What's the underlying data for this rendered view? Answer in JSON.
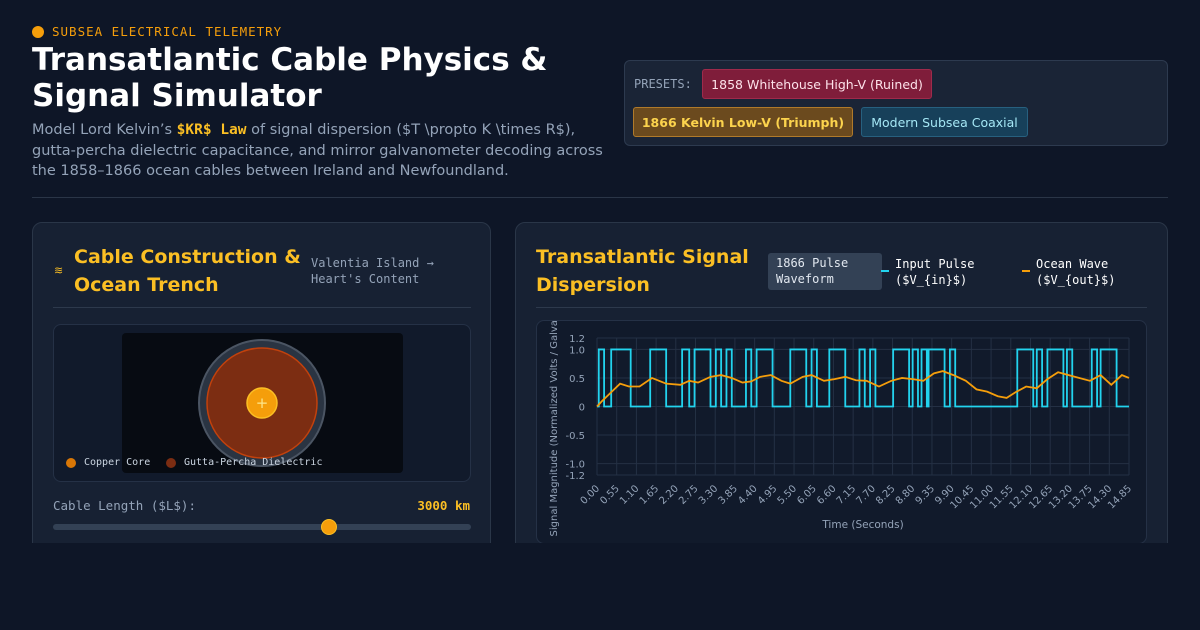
{
  "header": {
    "eyebrow": "SUBSEA ELECTRICAL TELEMETRY",
    "title": "Transatlantic Cable Physics & Signal Simulator",
    "desc_prefix": "Model Lord Kelvin’s ",
    "desc_code": "$KR$ Law",
    "desc_suffix": " of signal dispersion ($T \\propto K \\times R$), gutta-percha dielectric capacitance, and mirror galvanometer decoding across the 1858–1866 ocean cables between Ireland and Newfoundland."
  },
  "presets": {
    "label": "PRESETS:",
    "items": [
      {
        "label": "1858 Whitehouse High-V (Ruined)"
      },
      {
        "label": "1866 Kelvin Low-V (Triumph)"
      },
      {
        "label": "Modern Subsea Coaxial"
      }
    ]
  },
  "cable_panel": {
    "icon": "wave-icon",
    "title": "Cable Construction & Ocean Trench",
    "route": "Valentia Island → Heart's Content",
    "legend": [
      {
        "label": "Copper Core",
        "color": "#d97706"
      },
      {
        "label": "Gutta-Percha Dielectric",
        "color": "#7c2d12"
      }
    ],
    "length_label": "Cable Length ($L$):",
    "length_value": "3000 km",
    "length_fraction": 0.66
  },
  "signal_panel": {
    "title": "Transatlantic Signal Dispersion",
    "badge": "1866 Pulse Waveform",
    "legend": [
      {
        "label": "Input Pulse ($V_{in}$)",
        "color": "#22d3ee"
      },
      {
        "label": "Ocean Wave ($V_{out}$)",
        "color": "#f59e0b"
      }
    ]
  },
  "chart_data": {
    "type": "line",
    "xlabel": "Time (Seconds)",
    "ylabel": "Signal Magnitude (Normalized Volts / Galvanometer",
    "x_ticks": [
      "0.00",
      "0.55",
      "1.10",
      "1.65",
      "2.20",
      "2.75",
      "3.30",
      "3.85",
      "4.40",
      "4.95",
      "5.50",
      "6.05",
      "6.60",
      "7.15",
      "7.70",
      "8.25",
      "8.80",
      "9.35",
      "9.90",
      "10.45",
      "11.00",
      "11.55",
      "12.10",
      "12.65",
      "13.20",
      "13.75",
      "14.30",
      "14.85"
    ],
    "y_ticks": [
      1.2,
      1.0,
      0.5,
      0,
      -0.5,
      -1.0,
      -1.2
    ],
    "ylim": [
      -1.2,
      1.2
    ],
    "xlim": [
      0,
      15
    ],
    "grid": true,
    "series": [
      {
        "name": "Input Pulse ($V_{in}$)",
        "color": "#22d3ee",
        "step_points": [
          [
            0,
            0
          ],
          [
            0.05,
            1
          ],
          [
            0.2,
            0
          ],
          [
            0.4,
            1
          ],
          [
            0.95,
            0
          ],
          [
            1.5,
            1
          ],
          [
            1.95,
            0
          ],
          [
            2.4,
            1
          ],
          [
            2.6,
            0
          ],
          [
            2.75,
            1
          ],
          [
            3.2,
            0
          ],
          [
            3.35,
            1
          ],
          [
            3.5,
            0
          ],
          [
            3.65,
            1
          ],
          [
            3.8,
            0
          ],
          [
            4.2,
            1
          ],
          [
            4.35,
            0
          ],
          [
            4.5,
            1
          ],
          [
            4.95,
            0
          ],
          [
            5.45,
            1
          ],
          [
            5.9,
            0
          ],
          [
            6.05,
            1
          ],
          [
            6.2,
            0
          ],
          [
            6.55,
            1
          ],
          [
            7.0,
            0
          ],
          [
            7.4,
            1
          ],
          [
            7.55,
            0
          ],
          [
            7.7,
            1
          ],
          [
            7.85,
            0
          ],
          [
            8.35,
            1
          ],
          [
            8.8,
            0
          ],
          [
            8.9,
            1
          ],
          [
            9.05,
            0
          ],
          [
            9.15,
            1
          ],
          [
            9.3,
            0
          ],
          [
            9.35,
            1
          ],
          [
            9.8,
            0
          ],
          [
            9.95,
            1
          ],
          [
            10.1,
            0
          ],
          [
            11.2,
            0
          ],
          [
            11.85,
            1
          ],
          [
            12.3,
            0
          ],
          [
            12.4,
            1
          ],
          [
            12.55,
            0
          ],
          [
            12.7,
            1
          ],
          [
            13.15,
            0
          ],
          [
            13.25,
            1
          ],
          [
            13.4,
            0
          ],
          [
            13.95,
            1
          ],
          [
            14.1,
            0
          ],
          [
            14.2,
            1
          ],
          [
            14.65,
            0
          ],
          [
            15.0,
            0
          ]
        ]
      },
      {
        "name": "Ocean Wave ($V_{out}$)",
        "color": "#f59e0b",
        "points": [
          [
            0,
            0
          ],
          [
            0.15,
            0.1
          ],
          [
            0.4,
            0.25
          ],
          [
            0.65,
            0.4
          ],
          [
            0.9,
            0.35
          ],
          [
            1.2,
            0.35
          ],
          [
            1.55,
            0.5
          ],
          [
            1.95,
            0.4
          ],
          [
            2.35,
            0.38
          ],
          [
            2.6,
            0.45
          ],
          [
            2.85,
            0.42
          ],
          [
            3.2,
            0.52
          ],
          [
            3.5,
            0.55
          ],
          [
            3.8,
            0.5
          ],
          [
            4.1,
            0.42
          ],
          [
            4.35,
            0.44
          ],
          [
            4.6,
            0.52
          ],
          [
            4.9,
            0.55
          ],
          [
            5.2,
            0.45
          ],
          [
            5.45,
            0.4
          ],
          [
            5.8,
            0.52
          ],
          [
            6.05,
            0.55
          ],
          [
            6.4,
            0.45
          ],
          [
            6.7,
            0.48
          ],
          [
            7.0,
            0.52
          ],
          [
            7.3,
            0.46
          ],
          [
            7.6,
            0.45
          ],
          [
            7.95,
            0.35
          ],
          [
            8.3,
            0.45
          ],
          [
            8.6,
            0.5
          ],
          [
            8.9,
            0.48
          ],
          [
            9.2,
            0.45
          ],
          [
            9.5,
            0.58
          ],
          [
            9.75,
            0.62
          ],
          [
            10.05,
            0.55
          ],
          [
            10.4,
            0.45
          ],
          [
            10.7,
            0.3
          ],
          [
            11.0,
            0.26
          ],
          [
            11.3,
            0.18
          ],
          [
            11.55,
            0.15
          ],
          [
            11.8,
            0.25
          ],
          [
            12.1,
            0.35
          ],
          [
            12.4,
            0.32
          ],
          [
            12.7,
            0.48
          ],
          [
            13.0,
            0.6
          ],
          [
            13.3,
            0.55
          ],
          [
            13.6,
            0.5
          ],
          [
            13.9,
            0.45
          ],
          [
            14.2,
            0.55
          ],
          [
            14.5,
            0.38
          ],
          [
            14.8,
            0.55
          ],
          [
            15.0,
            0.5
          ]
        ]
      }
    ]
  }
}
